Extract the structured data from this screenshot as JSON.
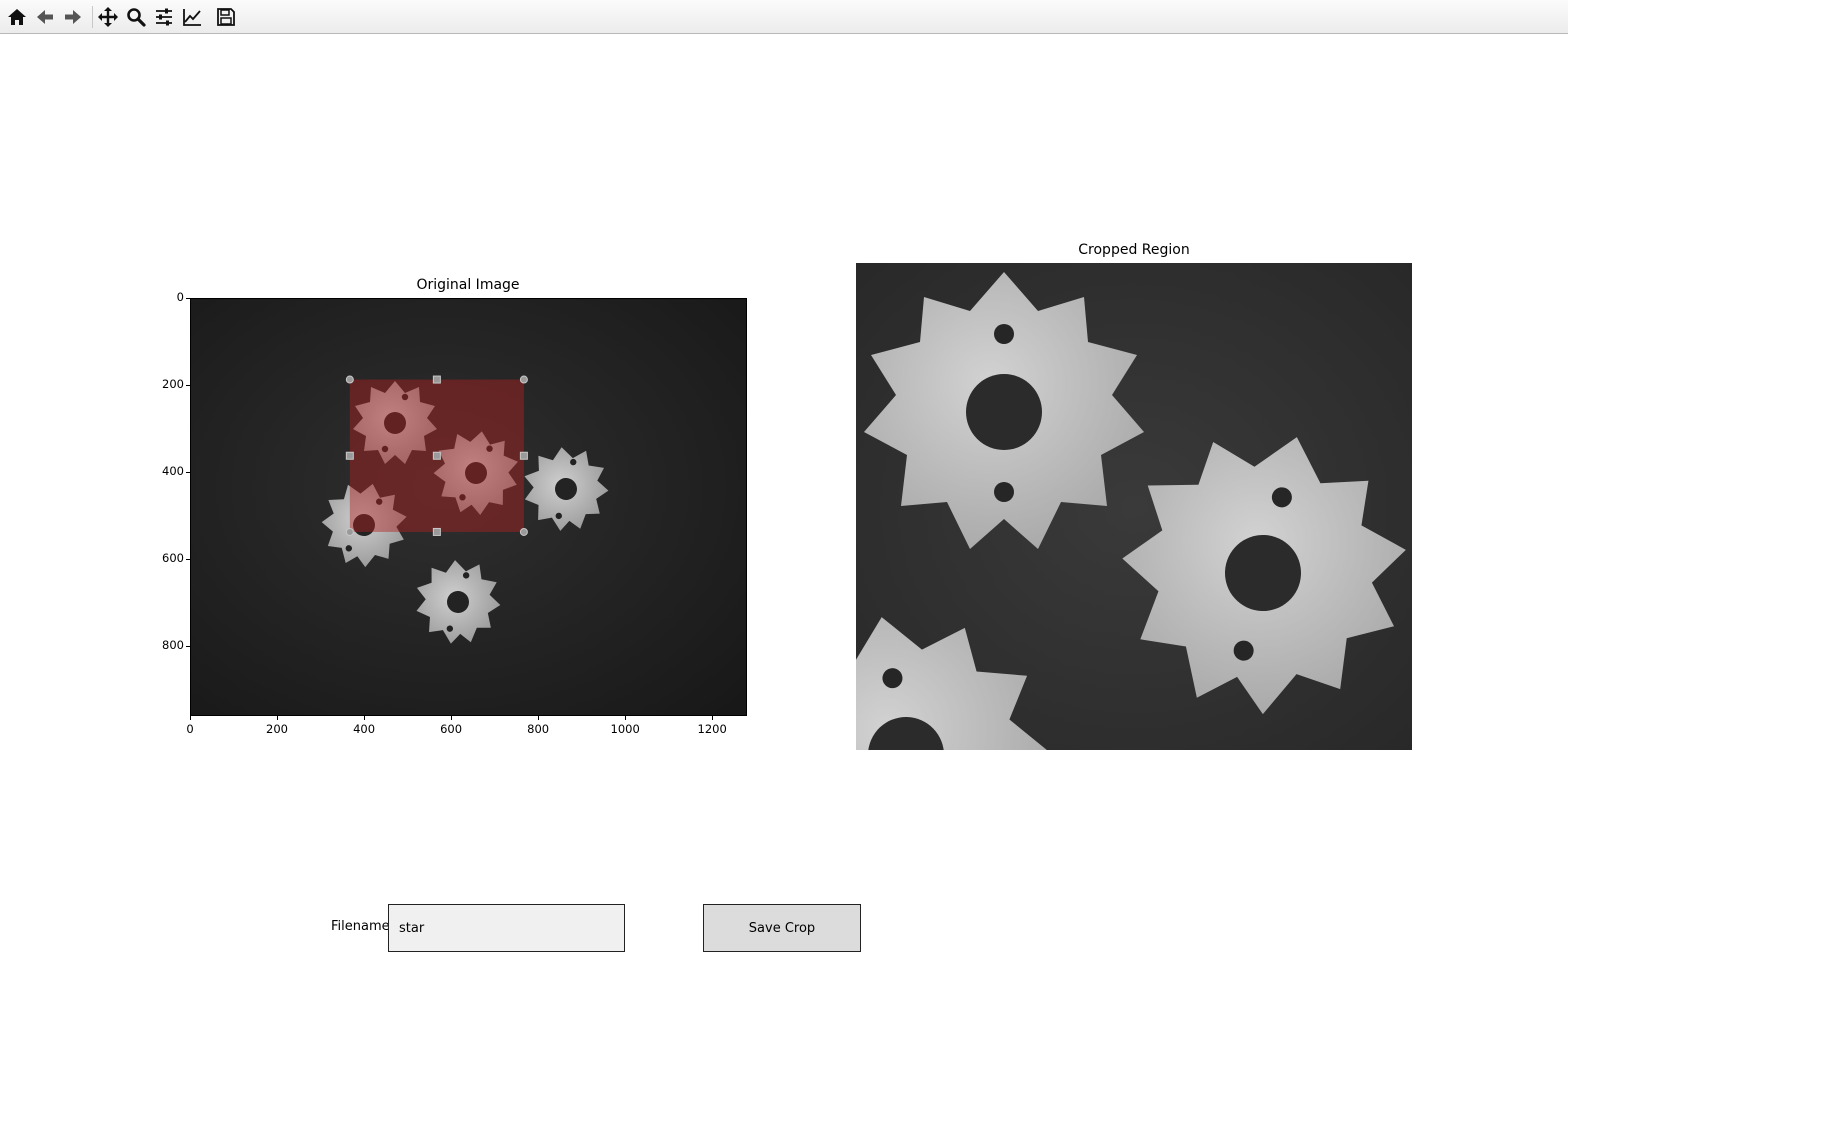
{
  "toolbar": {
    "buttons": [
      {
        "name": "home-icon",
        "tooltip": "Home"
      },
      {
        "name": "back-arrow-icon",
        "tooltip": "Back"
      },
      {
        "name": "forward-arrow-icon",
        "tooltip": "Forward"
      },
      {
        "name": "pan-icon",
        "tooltip": "Pan"
      },
      {
        "name": "zoom-icon",
        "tooltip": "Zoom"
      },
      {
        "name": "subplots-icon",
        "tooltip": "Subplots"
      },
      {
        "name": "customize-icon",
        "tooltip": "Customize"
      },
      {
        "name": "save-icon",
        "tooltip": "Save"
      }
    ]
  },
  "left_axes": {
    "title": "Original Image",
    "x_ticks": [
      "0",
      "200",
      "400",
      "600",
      "800",
      "1000",
      "1200"
    ],
    "y_ticks": [
      "0",
      "200",
      "400",
      "600",
      "800"
    ],
    "image_size": [
      1280,
      960
    ],
    "selection": {
      "x0": 365,
      "y0": 185,
      "x1": 765,
      "y1": 535,
      "color": "#b22222"
    }
  },
  "right_axes": {
    "title": "Cropped Region"
  },
  "controls": {
    "filename_label": "Filename",
    "filename_value": "star",
    "save_button": "Save Crop"
  }
}
